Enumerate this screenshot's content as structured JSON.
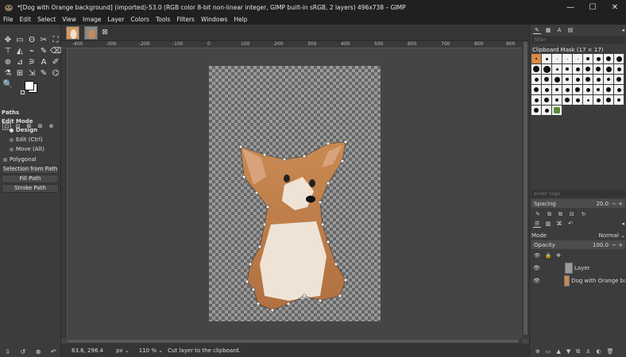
{
  "window": {
    "title": "*[Dog with Orange background] (imported)-53.0 (RGB color 8-bit non-linear integer, GIMP built-in sRGB, 2 layers) 496x738 – GIMP",
    "minimize": "—",
    "maximize": "☐",
    "close": "✕"
  },
  "menubar": {
    "items": [
      "File",
      "Edit",
      "Select",
      "View",
      "Image",
      "Layer",
      "Colors",
      "Tools",
      "Filters",
      "Windows",
      "Help"
    ]
  },
  "tabs": {
    "close_glyph": "⊠"
  },
  "toolbox": {
    "tools": [
      "✥",
      "▭",
      "ʘ",
      "✂",
      "⛶",
      "⊤",
      "◭",
      "⌁",
      "✎",
      "⌫",
      "⊕",
      "⊿",
      "⚞",
      "A",
      "✐",
      "⚗",
      "⊞",
      "⇲",
      "✎",
      "⌬",
      "🔍"
    ],
    "options_tabs": [
      "⊡",
      "⊟",
      "⊠",
      "⊞",
      "⊕"
    ],
    "paths_title": "Paths",
    "edit_mode_label": "Edit Mode",
    "mode_design": "Design",
    "mode_edit": "Edit (Ctrl)",
    "mode_move": "Move (Alt)",
    "polygonal_label": "Polygonal",
    "btn_selection_from_path": "Selection from Path",
    "btn_fill_path": "Fill Path",
    "btn_stroke_path": "Stroke Path",
    "bottom_icons": [
      "⇩",
      "↺",
      "⊗",
      "↶"
    ]
  },
  "ruler": {
    "top_labels": [
      "-400",
      "-300",
      "-200",
      "-100",
      "0",
      "100",
      "200",
      "300",
      "400",
      "500",
      "600",
      "700",
      "800",
      "900"
    ]
  },
  "canvas": {
    "image_colors": {
      "dog_body": "#c98a52",
      "dog_chest": "#efe3d5",
      "ear_inner": "#d8a27c"
    }
  },
  "status": {
    "coords": "63.6, 296.4",
    "unit": "px ⌄",
    "zoom": "110 % ⌄",
    "message": "Cut layer to the clipboard."
  },
  "dock": {
    "filter_placeholder": "filter",
    "brushes_title": "Clipboard Mask (17 × 17)",
    "tags_placeholder": "enter tags",
    "spacing_label": "Spacing",
    "spacing_value": "20.0",
    "layers_mode_label": "Mode",
    "layers_mode_value": "Normal ⌄",
    "opacity_label": "Opacity",
    "opacity_value": "100.0",
    "layers": [
      {
        "name": "Layer"
      },
      {
        "name": "Dog with Orange background"
      }
    ]
  }
}
